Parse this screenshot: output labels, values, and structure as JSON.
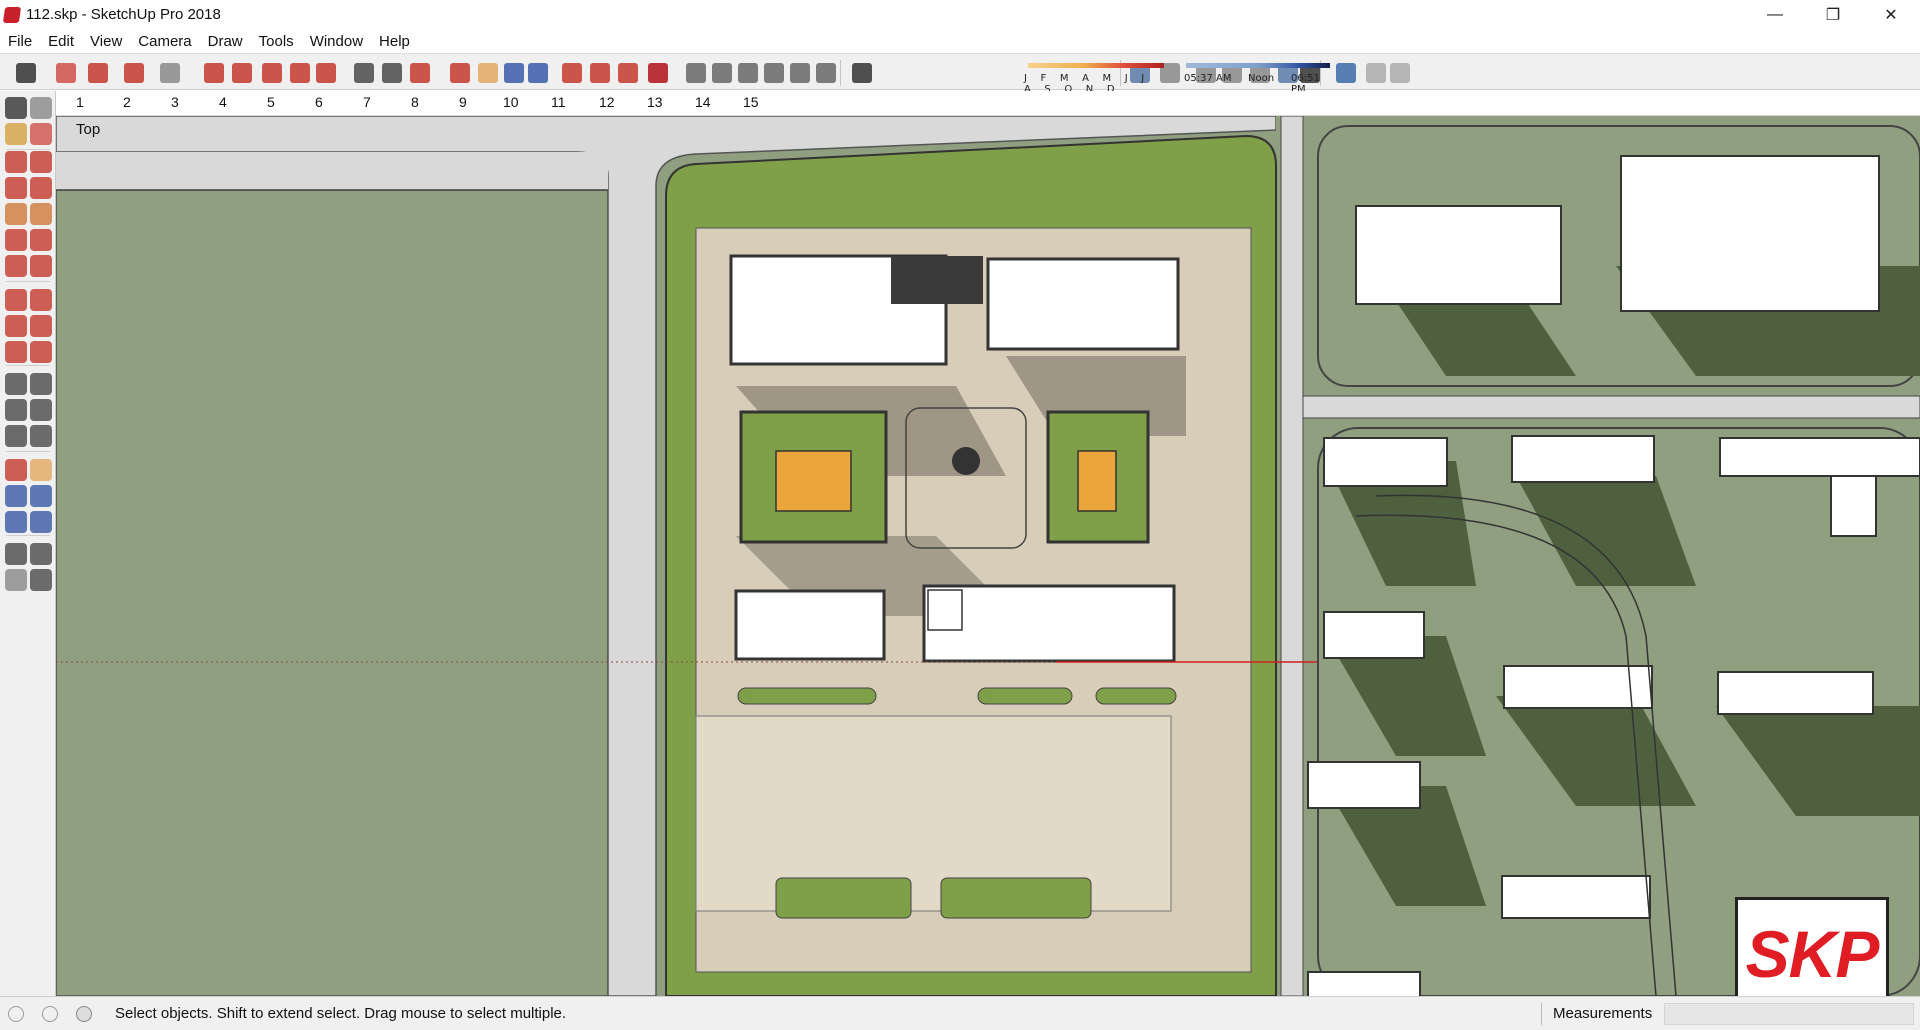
{
  "window": {
    "title": "112.skp - SketchUp Pro 2018",
    "controls": [
      "—",
      "❐",
      "✕"
    ]
  },
  "menu": [
    "File",
    "Edit",
    "View",
    "Camera",
    "Draw",
    "Tools",
    "Window",
    "Help"
  ],
  "toolbar": {
    "icons": [
      "select-icon",
      "eraser-icon",
      "pencil-icon",
      "arc-icon",
      "shape-icon",
      "push-pull-icon",
      "follow-me-icon",
      "move-icon",
      "rotate-icon",
      "scale-icon",
      "tape-measure-icon",
      "text-icon",
      "paint-bucket-icon",
      "orbit-icon",
      "pan-icon",
      "zoom-icon",
      "zoom-extents-icon",
      "warehouse-icon",
      "extension-warehouse-icon",
      "layout-icon",
      "ruby-icon",
      "iso-view-icon",
      "top-view-icon",
      "front-view-icon",
      "right-view-icon",
      "back-view-icon",
      "left-view-icon",
      "shadow-toggle-icon",
      "xray-icon",
      "back-edges-icon",
      "wireframe-icon",
      "hidden-line-icon",
      "shaded-icon",
      "shaded-textures-icon",
      "monochrome-icon",
      "geo-location-icon",
      "terrain-icon",
      "photo-texture-icon"
    ],
    "shadow_months": "J F M A M J J A S O N D",
    "sunrise": "05:37 AM",
    "noon": "Noon",
    "sunset": "06:51 PM"
  },
  "scenes": [
    "1",
    "2",
    "3",
    "4",
    "5",
    "6",
    "7",
    "8",
    "9",
    "10",
    "11",
    "12",
    "13",
    "14",
    "15"
  ],
  "left_tools": [
    "select-icon",
    "component-icon",
    "paint-bucket-icon",
    "eraser-icon",
    "line-icon",
    "freehand-icon",
    "rectangle-icon",
    "rotated-rectangle-icon",
    "circle-icon",
    "polygon-icon",
    "arc-icon",
    "pie-icon",
    "2pt-arc-icon",
    "3pt-arc-icon",
    "move-icon",
    "push-pull-icon",
    "rotate-icon",
    "follow-me-icon",
    "scale-icon",
    "offset-icon",
    "tape-measure-icon",
    "dimension-icon",
    "protractor-icon",
    "text-icon",
    "axes-icon",
    "3d-text-icon",
    "orbit-icon",
    "pan-icon",
    "zoom-icon",
    "zoom-window-icon",
    "zoom-extents-icon",
    "previous-view-icon",
    "position-camera-icon",
    "look-around-icon",
    "walk-icon",
    "section-plane-icon"
  ],
  "viewport": {
    "view_name": "Top"
  },
  "status": {
    "message": "Select objects. Shift to extend select. Drag mouse to select multiple.",
    "measurements_label": "Measurements",
    "measurements_value": ""
  },
  "watermark": "SKP",
  "colors": {
    "grass": "#8f9f80",
    "park_green": "#7f9f48",
    "paving": "#d7cdb8",
    "road": "#d9d9d9",
    "shadow": "#4a5a3a",
    "roof": "#ffffff",
    "orange_court": "#eaa63a",
    "axis_red": "#d0201c"
  }
}
